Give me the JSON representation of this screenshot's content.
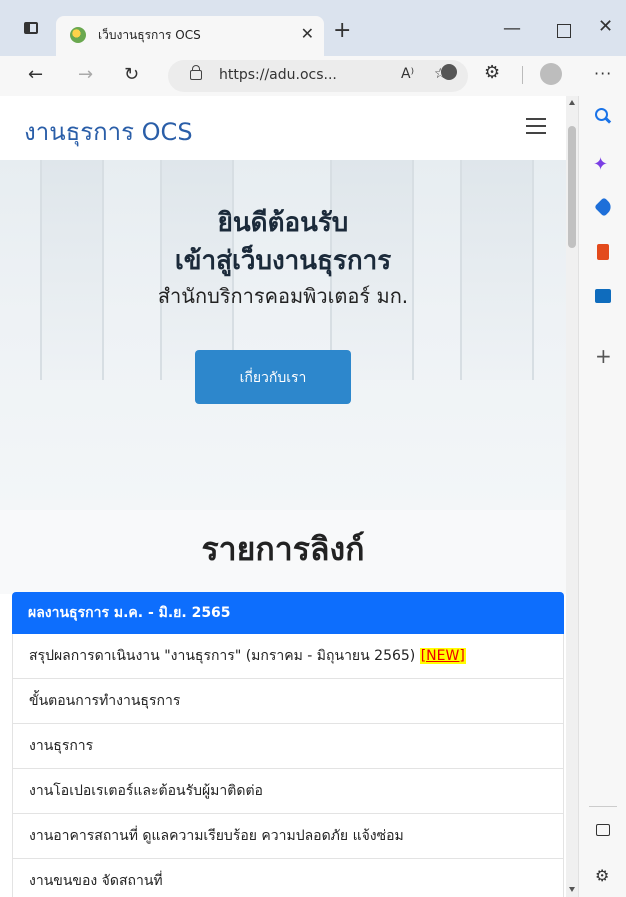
{
  "browser": {
    "tab_title": "เว็บงานธุรการ OCS",
    "url": "https://adu.ocs...",
    "new_tab": "+",
    "more": "···"
  },
  "site": {
    "brand": "งานธุรการ OCS",
    "hero": {
      "title_line1": "ยินดีต้อนรับ",
      "title_line2": "เข้าสู่เว็บงานธุรการ",
      "subtitle": "สำนักบริการคอมพิวเตอร์ มก.",
      "button": "เกี่ยวกับเรา"
    },
    "links_title": "รายการลิงก์",
    "list": {
      "active": "ผลงานธุรการ ม.ค. - มิ.ย. 2565",
      "items": [
        "สรุปผลการดาเนินงาน \"งานธุรการ\" (มกราคม - มิถุนายน 2565) ",
        "ขั้นตอนการทำงานธุรการ",
        "งานธุรการ",
        "งานโอเปอเรเตอร์และต้อนรับผู้มาติดต่อ",
        "งานอาคารสถานที่ ดูแลความเรียบร้อย ความปลอดภัย แจ้งซ่อม",
        "งานขนของ จัดสถานที่"
      ],
      "new_badge": "[NEW]"
    }
  },
  "colors": {
    "brand": "#2a5ea8",
    "active_item": "#0d6efd",
    "button": "#2d87cc",
    "new_highlight": "#ffff00"
  },
  "icons": [
    "window-menu-icon",
    "favicon",
    "close-tab-icon",
    "back-icon",
    "forward-icon",
    "reload-icon",
    "lock-icon",
    "read-aloud-icon",
    "favorites-icon",
    "extension-icon",
    "profile-icon",
    "hamburger-icon",
    "search-icon",
    "copilot-icon",
    "shopping-icon",
    "office-icon",
    "outlook-icon",
    "add-icon",
    "panel-icon",
    "settings-icon"
  ]
}
